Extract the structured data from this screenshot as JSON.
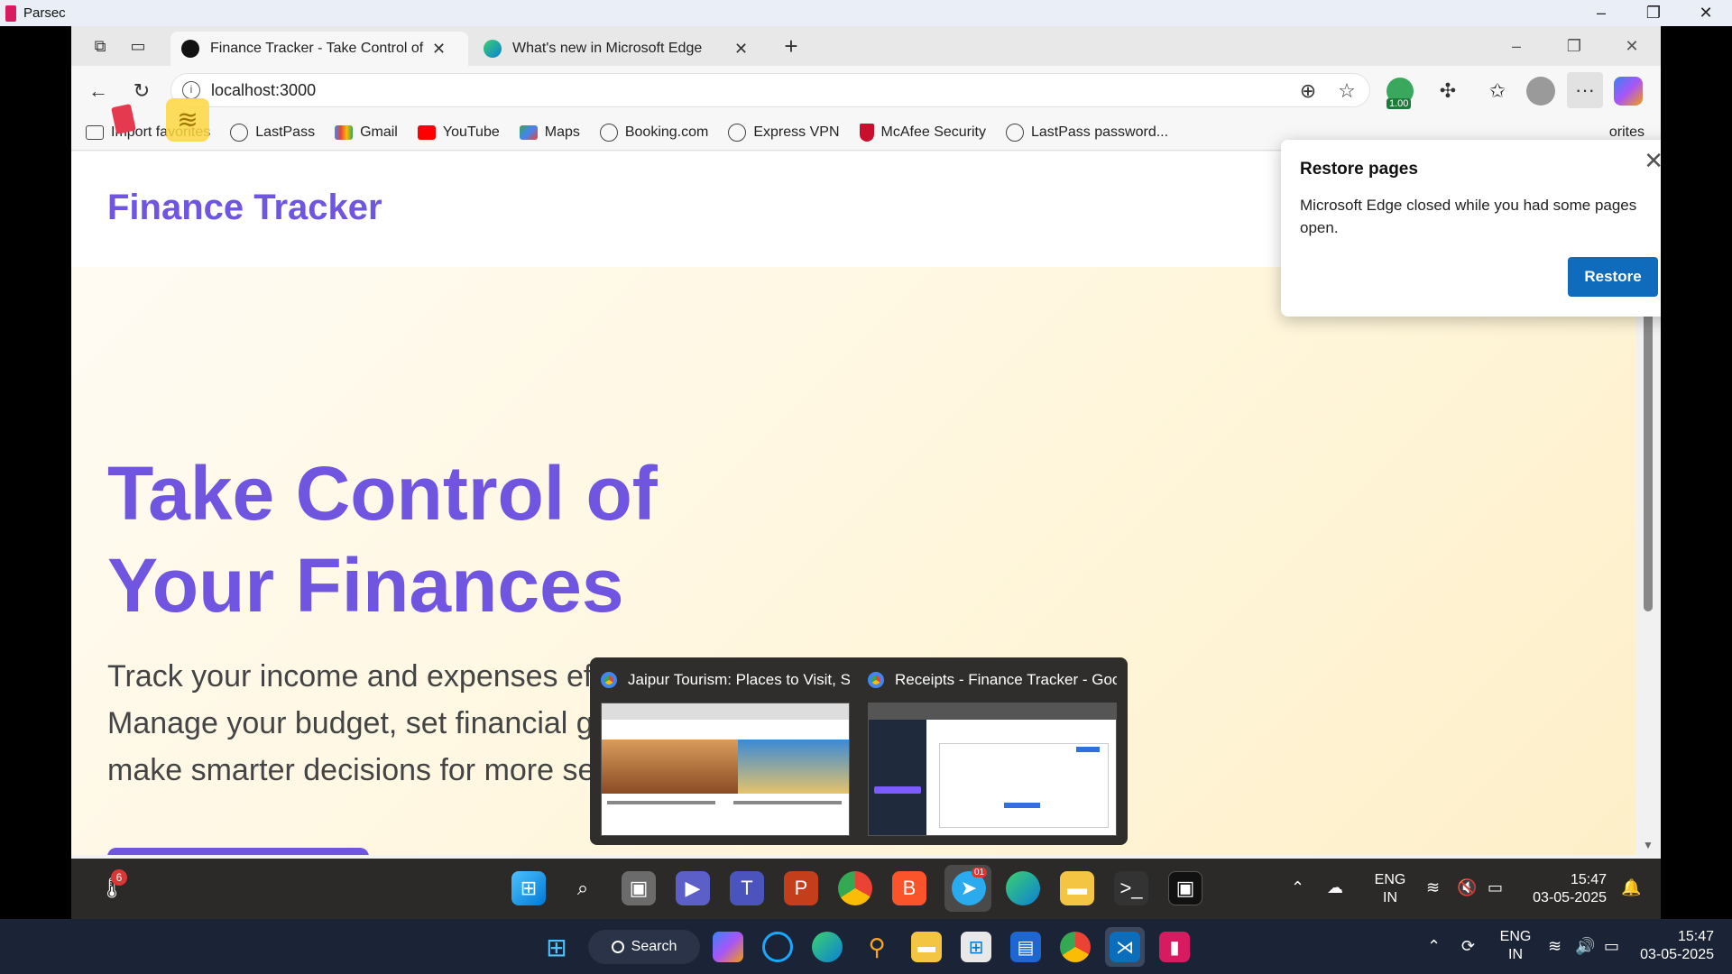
{
  "parsec": {
    "title": "Parsec",
    "minimize": "–",
    "restore": "❐",
    "close": "✕"
  },
  "browser": {
    "tabs": [
      {
        "title": "Finance Tracker - Take Control of Your Finances",
        "close": "✕"
      },
      {
        "title": "What's new in Microsoft Edge",
        "close": "✕"
      }
    ],
    "new_tab": "+",
    "window": {
      "minimize": "–",
      "restore": "❐",
      "close": "✕"
    },
    "address": {
      "url": "localhost:3000"
    },
    "extension_badge": "1.00",
    "bookmarks": [
      {
        "label": "Import favorites"
      },
      {
        "label": "LastPass"
      },
      {
        "label": "Gmail"
      },
      {
        "label": "YouTube"
      },
      {
        "label": "Maps"
      },
      {
        "label": "Booking.com"
      },
      {
        "label": "Express VPN"
      },
      {
        "label": "McAfee Security"
      },
      {
        "label": "LastPass password..."
      }
    ],
    "other_favorites": "orites"
  },
  "page": {
    "brand": "Finance Tracker",
    "hero_title": "Take Control of Your Finances",
    "hero_subtitle": "Track your income and expenses effortlessly. Manage your budget, set financial goals, and make smarter decisions for more secure future."
  },
  "restore_popup": {
    "title": "Restore pages",
    "body": "Microsoft Edge closed while you had some pages open.",
    "button": "Restore"
  },
  "previews": [
    {
      "title": "Jaipur Tourism: Places to Visit, S..."
    },
    {
      "title": "Receipts - Finance Tracker - Goo..."
    }
  ],
  "remote_taskbar": {
    "weather_badge": "6",
    "telegram_badge": "01",
    "lang_line1": "ENG",
    "lang_line2": "IN",
    "time": "15:47",
    "date": "03-05-2025"
  },
  "host_taskbar": {
    "search_label": "Search",
    "lang_line1": "ENG",
    "lang_line2": "IN",
    "time": "15:47",
    "date": "03-05-2025"
  },
  "colors": {
    "brand": "#6f55e0",
    "restore_button": "#0f6cbd"
  }
}
